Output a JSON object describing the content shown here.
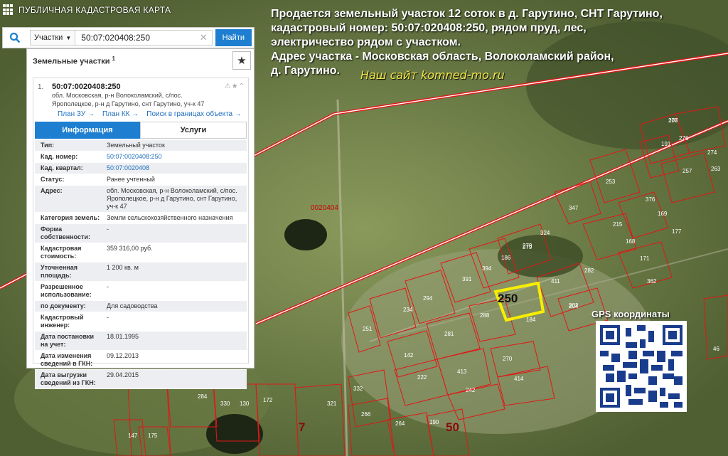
{
  "topbar": {
    "title": "ПУБЛИЧНАЯ КАДАСТРОВАЯ КАРТА"
  },
  "search": {
    "type_label": "Участки",
    "query": "50:07:020408:250",
    "find_label": "Найти"
  },
  "panel": {
    "title": "Земельные участки",
    "title_sup": "1",
    "item": {
      "index": "1.",
      "cad_number": "50:07:0020408:250",
      "address_line1": "обл. Московская, р-н Волоколамский, с/пос.",
      "address_line2": "Ярополецкое, р-н д Гарутино, снт Гарутино, уч-к 47",
      "links": [
        "План ЗУ →",
        "План КК →",
        "Поиск в границах объекта →"
      ]
    },
    "tabs": [
      "Информация",
      "Услуги"
    ],
    "info": [
      {
        "k": "Тип:",
        "v": "Земельный участок"
      },
      {
        "k": "Кад. номер:",
        "v": "50:07:0020408:250",
        "link": true
      },
      {
        "k": "Кад. квартал:",
        "v": "50:07:0020408",
        "link": true
      },
      {
        "k": "Статус:",
        "v": "Ранее учтенный"
      },
      {
        "k": "Адрес:",
        "v": "обл. Московская, р-н Волоколамский, с/пос. Ярополецкое, р-н д Гарутино, снт Гарутино, уч-к 47"
      },
      {
        "k": "Категория земель:",
        "v": "Земли сельскохозяйственного назначения"
      },
      {
        "k": "Форма собственности:",
        "v": "-"
      },
      {
        "k": "Кадастровая стоимость:",
        "v": "359 316,00 руб."
      },
      {
        "k": "Уточненная площадь:",
        "v": "1 200 кв. м"
      },
      {
        "k": "Разрешенное использование:",
        "v": "-"
      },
      {
        "k": "по документу:",
        "v": "Для садоводства"
      },
      {
        "k": "Кадастровый инженер:",
        "v": "-"
      },
      {
        "k": "Дата постановки на учет:",
        "v": "18.01.1995"
      },
      {
        "k": "Дата изменения сведений в ГКН:",
        "v": "09.12.2013"
      },
      {
        "k": "Дата выгрузки сведений из ГКН:",
        "v": "29.04.2015"
      }
    ]
  },
  "headline": {
    "line1": "Продается земельный участок 12 соток в д. Гарутино, СНТ Гарутино,",
    "line2": "кадастровый номер: 50:07:020408:250, рядом пруд, лес,",
    "line3": "электричество рядом с участком.",
    "line4": "Адрес участка - Московская область, Волоколамский район,",
    "line5": "д. Гарутино.",
    "site": "Наш сайт komned-mo.ru"
  },
  "map": {
    "quarter_label": "0020404",
    "target_label": "250",
    "label_50": "50",
    "label_7": "7",
    "parcel_labels": [
      "276",
      "276",
      "274",
      "191",
      "257",
      "263",
      "253",
      "347",
      "376",
      "169",
      "215",
      "177",
      "168",
      "171",
      "324",
      "279",
      "186",
      "282",
      "362",
      "394",
      "391",
      "411",
      "202",
      "279",
      "294",
      "234",
      "204",
      "46",
      "288",
      "184",
      "251",
      "281",
      "142",
      "270",
      "222",
      "413",
      "414",
      "242",
      "332",
      "266",
      "264",
      "190",
      "172",
      "130",
      "330",
      "284",
      "321",
      "147",
      "175",
      "107"
    ]
  },
  "gps": {
    "label": "GPS координаты"
  },
  "colors": {
    "parcel_border": "#e01818",
    "highlight": "#f7ee00",
    "accent": "#1e7fd1"
  }
}
